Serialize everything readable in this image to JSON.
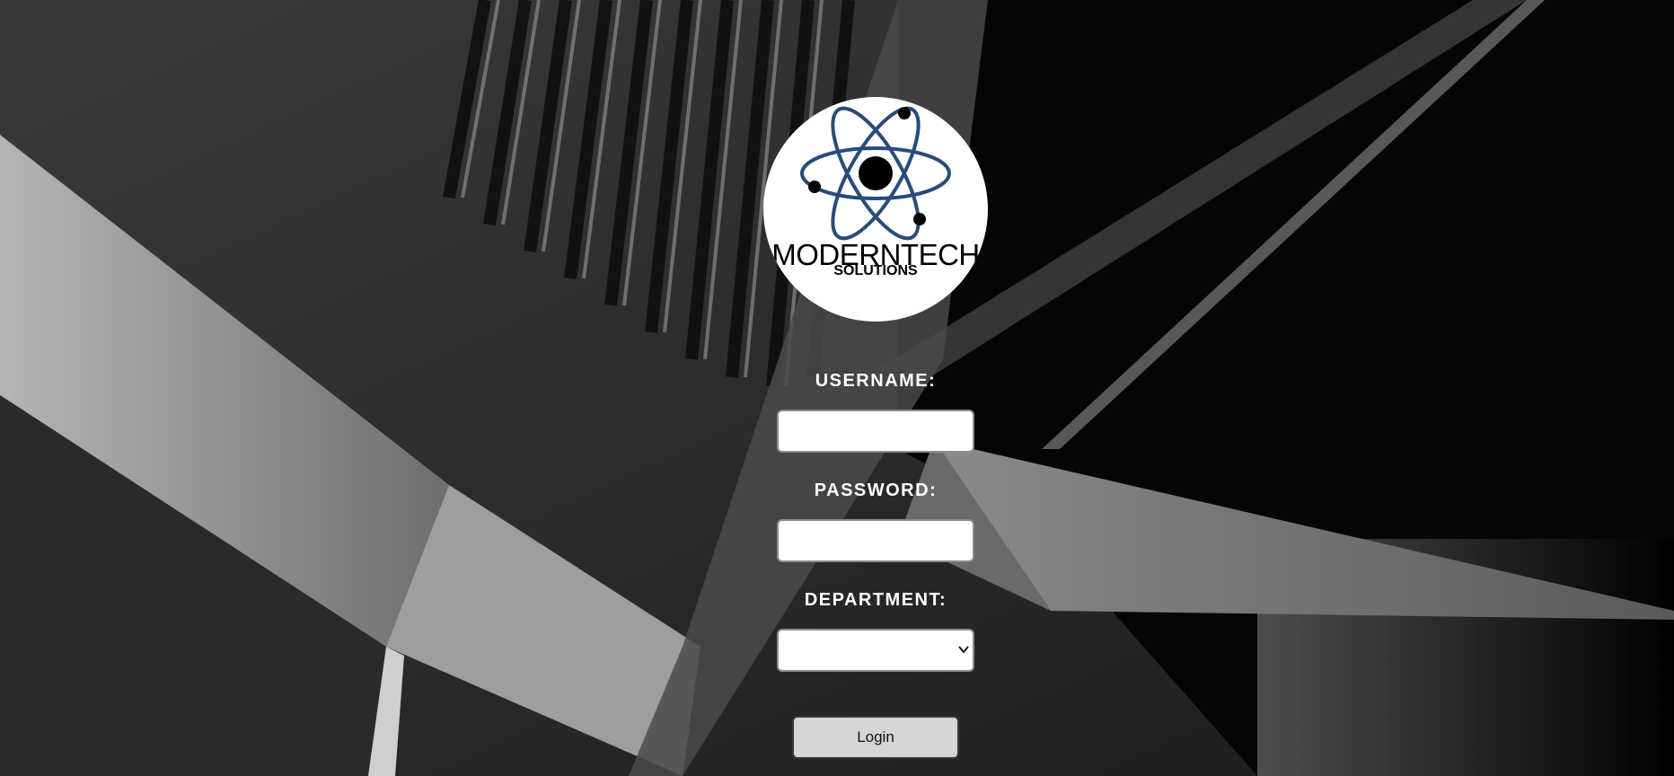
{
  "logo": {
    "title": "MODERNTECH",
    "subtitle": "SOLUTIONS",
    "icon": "atom-icon",
    "orbit_color": "#284b7a"
  },
  "form": {
    "username_label": "USERNAME:",
    "username_value": "",
    "password_label": "PASSWORD:",
    "password_value": "",
    "department_label": "DEPARTMENT:",
    "department_selected": "",
    "login_label": "Login"
  },
  "colors": {
    "label_text": "#ffffff",
    "button_bg": "#d5d5d5",
    "logo_bg": "#ffffff"
  }
}
